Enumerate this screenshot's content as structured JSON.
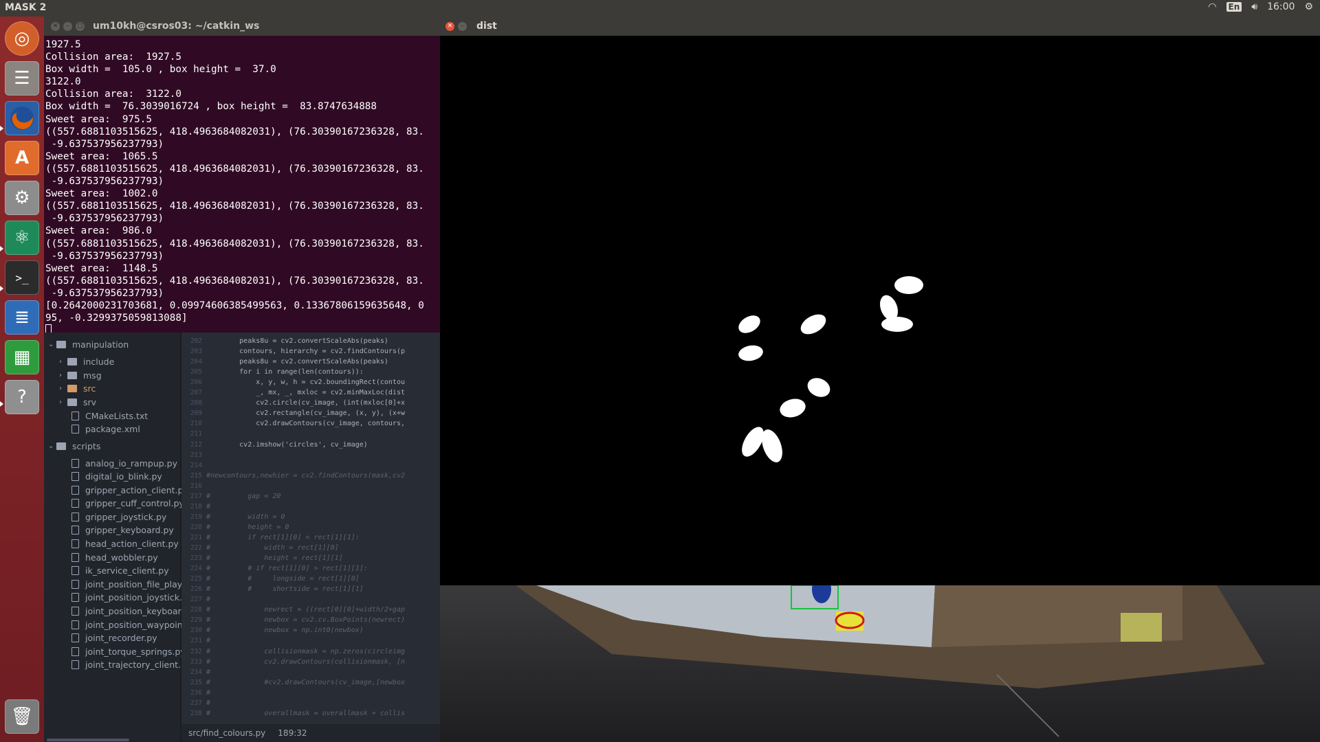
{
  "topbar": {
    "title": "MASK 2",
    "lang": "En",
    "time": "16:00"
  },
  "launcher": [
    "ubuntu-icon",
    "files-icon",
    "firefox-icon",
    "software-center-icon",
    "settings-icon",
    "atom-icon",
    "terminal-icon",
    "writer-icon",
    "calc-icon",
    "help-icon",
    "trash-icon"
  ],
  "terminal": {
    "title": "um10kh@csros03: ~/catkin_ws",
    "lines": [
      "1927.5",
      "Collision area:  1927.5",
      "Box width =  105.0 , box height =  37.0",
      "3122.0",
      "Collision area:  3122.0",
      "Box width =  76.3039016724 , box height =  83.8747634888",
      "Sweet area:  975.5",
      "((557.6881103515625, 418.4963684082031), (76.30390167236328, 83.",
      " -9.637537956237793)",
      "Sweet area:  1065.5",
      "((557.6881103515625, 418.4963684082031), (76.30390167236328, 83.",
      " -9.637537956237793)",
      "Sweet area:  1002.0",
      "((557.6881103515625, 418.4963684082031), (76.30390167236328, 83.",
      " -9.637537956237793)",
      "Sweet area:  986.0",
      "((557.6881103515625, 418.4963684082031), (76.30390167236328, 83.",
      " -9.637537956237793)",
      "Sweet area:  1148.5",
      "((557.6881103515625, 418.4963684082031), (76.30390167236328, 83.",
      " -9.637537956237793)",
      "[0.2642000231703681, 0.09974606385499563, 0.13367806159635648, 0",
      "95, -0.3299375059813088]"
    ]
  },
  "tree": {
    "items": [
      {
        "type": "dir",
        "open": true,
        "depth": 0,
        "label": "manipulation"
      },
      {
        "type": "dir",
        "open": false,
        "depth": 1,
        "label": "include"
      },
      {
        "type": "dir",
        "open": false,
        "depth": 1,
        "label": "msg"
      },
      {
        "type": "dir",
        "open": false,
        "depth": 1,
        "label": "src",
        "highlight": true
      },
      {
        "type": "dir",
        "open": false,
        "depth": 1,
        "label": "srv"
      },
      {
        "type": "file",
        "depth": 1,
        "label": "CMakeLists.txt"
      },
      {
        "type": "file",
        "depth": 1,
        "label": "package.xml"
      },
      {
        "type": "dir",
        "open": true,
        "depth": 0,
        "label": "scripts"
      },
      {
        "type": "file",
        "depth": 1,
        "label": "analog_io_rampup.py"
      },
      {
        "type": "file",
        "depth": 1,
        "label": "digital_io_blink.py"
      },
      {
        "type": "file",
        "depth": 1,
        "label": "gripper_action_client.py"
      },
      {
        "type": "file",
        "depth": 1,
        "label": "gripper_cuff_control.py"
      },
      {
        "type": "file",
        "depth": 1,
        "label": "gripper_joystick.py"
      },
      {
        "type": "file",
        "depth": 1,
        "label": "gripper_keyboard.py"
      },
      {
        "type": "file",
        "depth": 1,
        "label": "head_action_client.py"
      },
      {
        "type": "file",
        "depth": 1,
        "label": "head_wobbler.py"
      },
      {
        "type": "file",
        "depth": 1,
        "label": "ik_service_client.py"
      },
      {
        "type": "file",
        "depth": 1,
        "label": "joint_position_file_playl"
      },
      {
        "type": "file",
        "depth": 1,
        "label": "joint_position_joystick.p"
      },
      {
        "type": "file",
        "depth": 1,
        "label": "joint_position_keyboarc"
      },
      {
        "type": "file",
        "depth": 1,
        "label": "joint_position_waypoint"
      },
      {
        "type": "file",
        "depth": 1,
        "label": "joint_recorder.py"
      },
      {
        "type": "file",
        "depth": 1,
        "label": "joint_torque_springs.py"
      },
      {
        "type": "file",
        "depth": 1,
        "label": "joint_trajectory_client.p"
      }
    ]
  },
  "editor": {
    "lines": [
      {
        "n": "202",
        "t": "        peaks8u = cv2.convertScaleAbs(peaks)",
        "c": false
      },
      {
        "n": "203",
        "t": "        contours, hierarchy = cv2.findContours(p",
        "c": false
      },
      {
        "n": "204",
        "t": "        peaks8u = cv2.convertScaleAbs(peaks)",
        "c": false
      },
      {
        "n": "205",
        "t": "        for i in range(len(contours)):",
        "c": false
      },
      {
        "n": "206",
        "t": "            x, y, w, h = cv2.boundingRect(contou",
        "c": false
      },
      {
        "n": "207",
        "t": "            _, mx, _, mxloc = cv2.minMaxLoc(dist",
        "c": false
      },
      {
        "n": "208",
        "t": "            cv2.circle(cv_image, (int(mxloc[0]+x",
        "c": false
      },
      {
        "n": "209",
        "t": "            cv2.rectangle(cv_image, (x, y), (x+w",
        "c": false
      },
      {
        "n": "210",
        "t": "            cv2.drawContours(cv_image, contours,",
        "c": false
      },
      {
        "n": "211",
        "t": "",
        "c": false
      },
      {
        "n": "212",
        "t": "        cv2.imshow('circles', cv_image)",
        "c": false
      },
      {
        "n": "213",
        "t": "",
        "c": false
      },
      {
        "n": "214",
        "t": "",
        "c": false
      },
      {
        "n": "215",
        "t": "#newcontours,newhier = cv2.findContours(mask,cv2",
        "c": true
      },
      {
        "n": "216",
        "t": "",
        "c": false
      },
      {
        "n": "217",
        "t": "#         gap = 20",
        "c": true
      },
      {
        "n": "218",
        "t": "#",
        "c": true
      },
      {
        "n": "219",
        "t": "#         width = 0",
        "c": true
      },
      {
        "n": "220",
        "t": "#         height = 0",
        "c": true
      },
      {
        "n": "221",
        "t": "#         if rect[1][0] < rect[1][1]:",
        "c": true
      },
      {
        "n": "222",
        "t": "#             width = rect[1][0]",
        "c": true
      },
      {
        "n": "223",
        "t": "#             height = rect[1][1]",
        "c": true
      },
      {
        "n": "224",
        "t": "#         # if rect[1][0] > rect[1][1]:",
        "c": true
      },
      {
        "n": "225",
        "t": "#         #     longside = rect[1][0]",
        "c": true
      },
      {
        "n": "226",
        "t": "#         #     shortside = rect[1][1]",
        "c": true
      },
      {
        "n": "227",
        "t": "#",
        "c": true
      },
      {
        "n": "228",
        "t": "#             newrect = ((rect[0][0]+width/2+gap",
        "c": true
      },
      {
        "n": "229",
        "t": "#             newbox = cv2.cv.BoxPoints(newrect)",
        "c": true
      },
      {
        "n": "230",
        "t": "#             newbox = np.int0(newbox)",
        "c": true
      },
      {
        "n": "231",
        "t": "#",
        "c": true
      },
      {
        "n": "232",
        "t": "#             collisionmask = np.zeros(circleimg",
        "c": true
      },
      {
        "n": "233",
        "t": "#             cv2.drawContours(collisionmask, [n",
        "c": true
      },
      {
        "n": "234",
        "t": "#",
        "c": true
      },
      {
        "n": "235",
        "t": "#             #cv2.drawContours(cv_image,[newbox",
        "c": true
      },
      {
        "n": "236",
        "t": "#",
        "c": true
      },
      {
        "n": "237",
        "t": "#",
        "c": true
      },
      {
        "n": "238",
        "t": "#             overallmask = overallmask + collis",
        "c": true
      }
    ],
    "status_file": "src/find_colours.py",
    "status_pos": "189:32"
  },
  "dist_window": {
    "title": "dist"
  },
  "colors": {
    "terminal_bg": "#300a24",
    "launcher": "#7d2428",
    "editor_bg": "#282c34",
    "panel": "#3c3b37"
  }
}
